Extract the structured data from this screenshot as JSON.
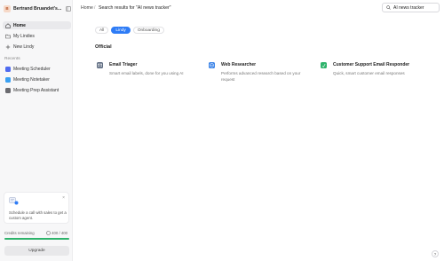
{
  "workspace": {
    "initial": "B",
    "name": "Bertrand Bruandet's..."
  },
  "sidebar": {
    "nav": [
      {
        "label": "Home",
        "icon": "home-icon",
        "active": true
      },
      {
        "label": "My Lindies",
        "icon": "folder-icon",
        "active": false
      },
      {
        "label": "New Lindy",
        "icon": "plus-icon",
        "active": false
      }
    ],
    "recents_label": "Recents",
    "recents": [
      {
        "label": "Meeting Scheduler",
        "color": "#4f6bf0"
      },
      {
        "label": "Meeting Notetaker",
        "color": "#3aa0f2"
      },
      {
        "label": "Meeting Prep Assistant",
        "color": "#6b6b70"
      }
    ]
  },
  "promo": {
    "text": "Schedule a call with sales to get a custom agent."
  },
  "credits": {
    "label": "Credits remaining",
    "value": "400 / 400",
    "fraction": 1.0
  },
  "upgrade_label": "Upgrade",
  "breadcrumb": {
    "home": "Home",
    "separator": "/",
    "current": "Search results for \"AI news tracker\""
  },
  "search": {
    "value": "AI news tracker"
  },
  "filters": [
    {
      "label": "All",
      "active": false
    },
    {
      "label": "Lindy",
      "active": true
    },
    {
      "label": "Onboarding",
      "active": false
    }
  ],
  "group_title": "Official",
  "cards": [
    {
      "title": "Email Triager",
      "desc": "Smart email labels, done for you using AI",
      "icon_color": "#5d6b80"
    },
    {
      "title": "Web Researcher",
      "desc": "Performs advanced research based on your request",
      "icon_color": "#3f86e8"
    },
    {
      "title": "Customer Support Email Responder",
      "desc": "Quick, smart customer email responses",
      "icon_color": "#2fb36b"
    }
  ],
  "help_label": "?",
  "colors": {
    "accent": "#2e7cf6",
    "credits_bar": "#2fb36b"
  }
}
